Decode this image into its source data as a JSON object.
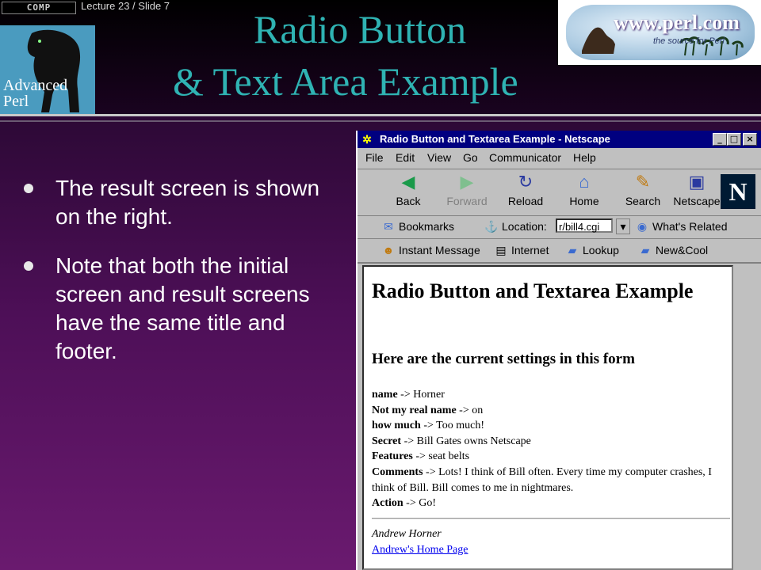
{
  "header": {
    "comp_logo": "COMP",
    "lecture": "Lecture 23 / Slide 7",
    "course_logo": [
      "Advanced",
      "Perl"
    ],
    "title_line1": "Radio Button",
    "title_line2": "& Text Area Example",
    "perl_url": "www.perl.com",
    "perl_tagline": "the source for Perl"
  },
  "bullets": [
    "The result screen is shown on the right.",
    "Note that both the initial screen and result screens have the same title and footer."
  ],
  "browser": {
    "title": "Radio Button and Textarea Example - Netscape",
    "menus": [
      "File",
      "Edit",
      "View",
      "Go",
      "Communicator",
      "Help"
    ],
    "nav": [
      {
        "label": "Back",
        "icon": "back-arrow-icon",
        "enabled": true
      },
      {
        "label": "Forward",
        "icon": "forward-arrow-icon",
        "enabled": false
      },
      {
        "label": "Reload",
        "icon": "reload-icon",
        "enabled": true
      },
      {
        "label": "Home",
        "icon": "home-icon",
        "enabled": true
      },
      {
        "label": "Search",
        "icon": "search-icon",
        "enabled": true
      },
      {
        "label": "Netscape",
        "icon": "netscape-icon",
        "enabled": true
      }
    ],
    "bookmarks_label": "Bookmarks",
    "location_label": "Location:",
    "location_value": "r/bill4.cgi",
    "whats_related": "What's Related",
    "personal": [
      "Instant Message",
      "Internet",
      "Lookup",
      "New&Cool"
    ],
    "page": {
      "heading": "Radio Button and Textarea Example",
      "subheading": "Here are the current settings in this form",
      "settings": [
        {
          "key": "name",
          "value": "Horner"
        },
        {
          "key": "Not my real name",
          "value": "on"
        },
        {
          "key": "how much",
          "value": "Too much!"
        },
        {
          "key": "Secret",
          "value": "Bill Gates owns Netscape"
        },
        {
          "key": "Features",
          "value": "seat belts"
        },
        {
          "key": "Comments",
          "value": "Lots! I think of Bill often. Every time my computer crashes, I think of Bill. Bill comes to me in nightmares."
        },
        {
          "key": "Action",
          "value": "Go!"
        }
      ],
      "arrow": "->",
      "author": "Andrew Horner",
      "home_link": "Andrew's Home Page"
    }
  }
}
